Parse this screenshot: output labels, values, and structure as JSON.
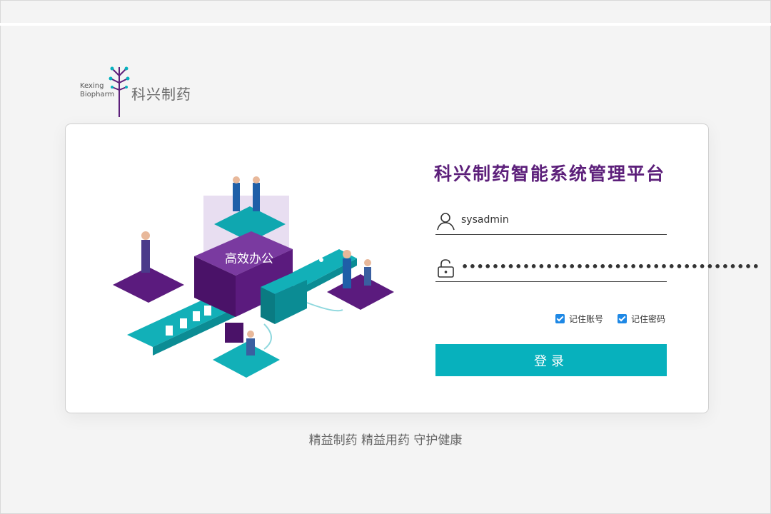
{
  "brand": {
    "en_line1": "Kexing",
    "en_line2": "Biopharm",
    "cn_name": "科兴制药"
  },
  "login": {
    "title": "科兴制药智能系统管理平台",
    "username_value": "sysadmin",
    "password_mask": "•••••••••••••••••••••••••••••••••••••••",
    "remember_account_label": "记住账号",
    "remember_account_checked": true,
    "remember_password_label": "记住密码",
    "remember_password_checked": true,
    "submit_label": "登录"
  },
  "illustration": {
    "center_label": "高效办公"
  },
  "colors": {
    "brand_purple": "#5c1f7a",
    "accent_teal": "#07b1bd",
    "checkbox_blue": "#1e88e5"
  },
  "footer": {
    "slogan": "精益制药 精益用药 守护健康"
  }
}
